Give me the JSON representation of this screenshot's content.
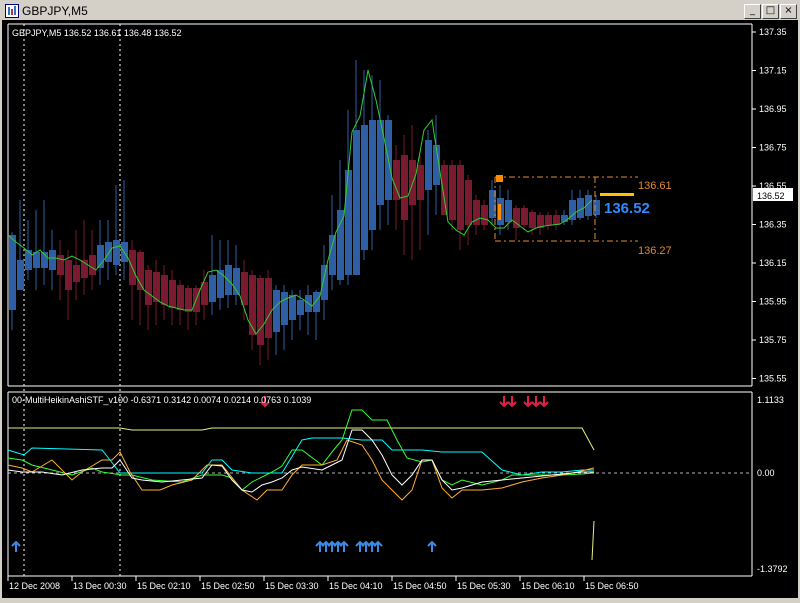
{
  "window": {
    "title": "GBPJPY,M5",
    "buttons": {
      "minimize": "_",
      "maximize": "□",
      "close": "×"
    }
  },
  "main_chart": {
    "info": "GBPJPY,M5  136.52 136.61 136.48 136.52",
    "price_labels": [
      "137.35",
      "137.15",
      "136.95",
      "136.75",
      "136.55",
      "136.35",
      "136.15",
      "135.95",
      "135.75",
      "135.55"
    ],
    "current_price_tag": "136.52",
    "range_high": "136.61",
    "range_low": "136.27",
    "big_price": "136.52"
  },
  "indicator": {
    "info": "00-MultiHeikinAshiSTF_v100 -0.6371 0.3142 0.0074 0.0214 0.0763 0.1039",
    "scale_top": "1.1133",
    "scale_zero": "0.00",
    "scale_bottom": "-1.3792"
  },
  "time_axis": [
    "12 Dec 2008",
    "13 Dec 00:30",
    "15 Dec 02:10",
    "15 Dec 02:50",
    "15 Dec 03:30",
    "15 Dec 04:10",
    "15 Dec 04:50",
    "15 Dec 05:30",
    "15 Dec 06:10",
    "15 Dec 06:50"
  ],
  "colors": {
    "bull_candle": "#2e5fa5",
    "bear_candle": "#7a1a2e",
    "ma_line": "#33cc33",
    "range_box": "#e08a2e",
    "big_price": "#2e8bff",
    "up_arrow": "#3b8be6",
    "down_arrow": "#e0204a"
  }
}
